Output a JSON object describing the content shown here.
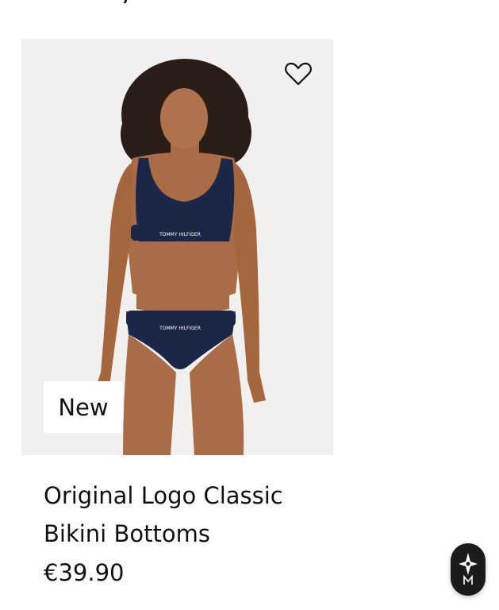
{
  "product": {
    "badge_label": "New",
    "name_line1": "Original Logo Classic",
    "name_line2": "Bikini Bottoms",
    "price": "€39.90",
    "brand_waistband_text": "TOMMY HILFIGER",
    "wishlist_icon": "heart-outline-icon",
    "image_alt": "Model wearing navy bralette and navy bikini bottoms"
  },
  "floating_button": {
    "icon": "compass-star-icon"
  },
  "colors": {
    "navy": "#1c2747",
    "badge_bg": "#ffffff",
    "text": "#111111",
    "fab_bg": "#1b1b1d"
  }
}
